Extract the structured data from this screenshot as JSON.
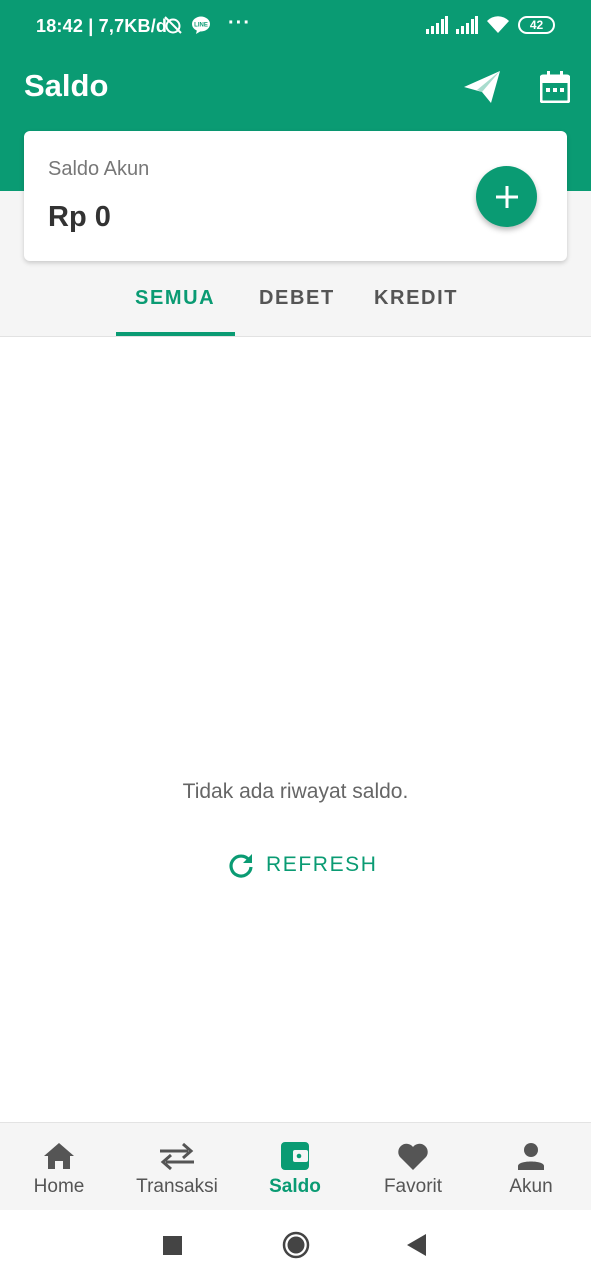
{
  "status_bar": {
    "time": "18:42 | 7,7KB/d",
    "more": "···",
    "battery": "42"
  },
  "header": {
    "title": "Saldo"
  },
  "balance": {
    "label": "Saldo Akun",
    "value": "Rp 0"
  },
  "tabs": [
    {
      "label": "SEMUA",
      "active": true
    },
    {
      "label": "DEBET",
      "active": false
    },
    {
      "label": "KREDIT",
      "active": false
    }
  ],
  "empty_state": {
    "message": "Tidak ada riwayat saldo.",
    "refresh_label": "REFRESH"
  },
  "bottom_nav": {
    "items": [
      {
        "label": "Home",
        "icon": "home-icon"
      },
      {
        "label": "Transaksi",
        "icon": "swap-icon"
      },
      {
        "label": "Saldo",
        "icon": "wallet-icon",
        "active": true
      },
      {
        "label": "Favorit",
        "icon": "heart-icon"
      },
      {
        "label": "Akun",
        "icon": "person-icon"
      }
    ]
  },
  "colors": {
    "primary": "#0a9b73",
    "tab_bg": "#f5f5f5",
    "text_muted": "#666666"
  }
}
